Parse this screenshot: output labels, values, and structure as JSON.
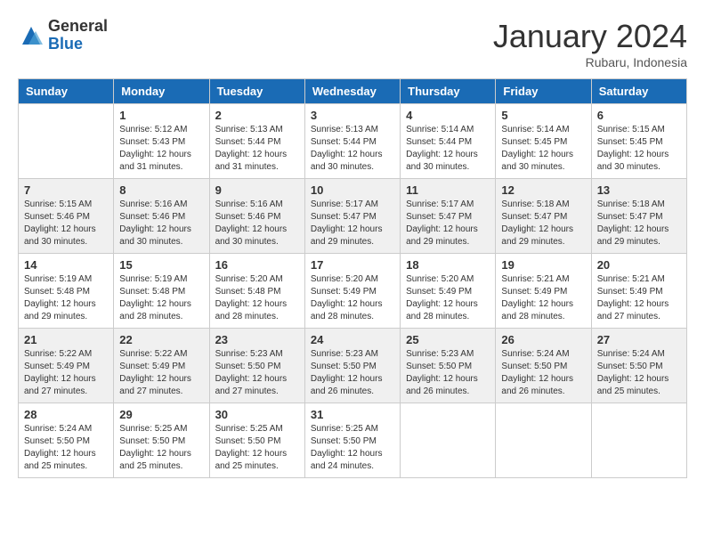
{
  "logo": {
    "general": "General",
    "blue": "Blue"
  },
  "title": "January 2024",
  "location": "Rubaru, Indonesia",
  "days_header": [
    "Sunday",
    "Monday",
    "Tuesday",
    "Wednesday",
    "Thursday",
    "Friday",
    "Saturday"
  ],
  "weeks": [
    [
      {
        "day": "",
        "sunrise": "",
        "sunset": "",
        "daylight": ""
      },
      {
        "day": "1",
        "sunrise": "Sunrise: 5:12 AM",
        "sunset": "Sunset: 5:43 PM",
        "daylight": "Daylight: 12 hours and 31 minutes."
      },
      {
        "day": "2",
        "sunrise": "Sunrise: 5:13 AM",
        "sunset": "Sunset: 5:44 PM",
        "daylight": "Daylight: 12 hours and 31 minutes."
      },
      {
        "day": "3",
        "sunrise": "Sunrise: 5:13 AM",
        "sunset": "Sunset: 5:44 PM",
        "daylight": "Daylight: 12 hours and 30 minutes."
      },
      {
        "day": "4",
        "sunrise": "Sunrise: 5:14 AM",
        "sunset": "Sunset: 5:44 PM",
        "daylight": "Daylight: 12 hours and 30 minutes."
      },
      {
        "day": "5",
        "sunrise": "Sunrise: 5:14 AM",
        "sunset": "Sunset: 5:45 PM",
        "daylight": "Daylight: 12 hours and 30 minutes."
      },
      {
        "day": "6",
        "sunrise": "Sunrise: 5:15 AM",
        "sunset": "Sunset: 5:45 PM",
        "daylight": "Daylight: 12 hours and 30 minutes."
      }
    ],
    [
      {
        "day": "7",
        "sunrise": "Sunrise: 5:15 AM",
        "sunset": "Sunset: 5:46 PM",
        "daylight": "Daylight: 12 hours and 30 minutes."
      },
      {
        "day": "8",
        "sunrise": "Sunrise: 5:16 AM",
        "sunset": "Sunset: 5:46 PM",
        "daylight": "Daylight: 12 hours and 30 minutes."
      },
      {
        "day": "9",
        "sunrise": "Sunrise: 5:16 AM",
        "sunset": "Sunset: 5:46 PM",
        "daylight": "Daylight: 12 hours and 30 minutes."
      },
      {
        "day": "10",
        "sunrise": "Sunrise: 5:17 AM",
        "sunset": "Sunset: 5:47 PM",
        "daylight": "Daylight: 12 hours and 29 minutes."
      },
      {
        "day": "11",
        "sunrise": "Sunrise: 5:17 AM",
        "sunset": "Sunset: 5:47 PM",
        "daylight": "Daylight: 12 hours and 29 minutes."
      },
      {
        "day": "12",
        "sunrise": "Sunrise: 5:18 AM",
        "sunset": "Sunset: 5:47 PM",
        "daylight": "Daylight: 12 hours and 29 minutes."
      },
      {
        "day": "13",
        "sunrise": "Sunrise: 5:18 AM",
        "sunset": "Sunset: 5:47 PM",
        "daylight": "Daylight: 12 hours and 29 minutes."
      }
    ],
    [
      {
        "day": "14",
        "sunrise": "Sunrise: 5:19 AM",
        "sunset": "Sunset: 5:48 PM",
        "daylight": "Daylight: 12 hours and 29 minutes."
      },
      {
        "day": "15",
        "sunrise": "Sunrise: 5:19 AM",
        "sunset": "Sunset: 5:48 PM",
        "daylight": "Daylight: 12 hours and 28 minutes."
      },
      {
        "day": "16",
        "sunrise": "Sunrise: 5:20 AM",
        "sunset": "Sunset: 5:48 PM",
        "daylight": "Daylight: 12 hours and 28 minutes."
      },
      {
        "day": "17",
        "sunrise": "Sunrise: 5:20 AM",
        "sunset": "Sunset: 5:49 PM",
        "daylight": "Daylight: 12 hours and 28 minutes."
      },
      {
        "day": "18",
        "sunrise": "Sunrise: 5:20 AM",
        "sunset": "Sunset: 5:49 PM",
        "daylight": "Daylight: 12 hours and 28 minutes."
      },
      {
        "day": "19",
        "sunrise": "Sunrise: 5:21 AM",
        "sunset": "Sunset: 5:49 PM",
        "daylight": "Daylight: 12 hours and 28 minutes."
      },
      {
        "day": "20",
        "sunrise": "Sunrise: 5:21 AM",
        "sunset": "Sunset: 5:49 PM",
        "daylight": "Daylight: 12 hours and 27 minutes."
      }
    ],
    [
      {
        "day": "21",
        "sunrise": "Sunrise: 5:22 AM",
        "sunset": "Sunset: 5:49 PM",
        "daylight": "Daylight: 12 hours and 27 minutes."
      },
      {
        "day": "22",
        "sunrise": "Sunrise: 5:22 AM",
        "sunset": "Sunset: 5:49 PM",
        "daylight": "Daylight: 12 hours and 27 minutes."
      },
      {
        "day": "23",
        "sunrise": "Sunrise: 5:23 AM",
        "sunset": "Sunset: 5:50 PM",
        "daylight": "Daylight: 12 hours and 27 minutes."
      },
      {
        "day": "24",
        "sunrise": "Sunrise: 5:23 AM",
        "sunset": "Sunset: 5:50 PM",
        "daylight": "Daylight: 12 hours and 26 minutes."
      },
      {
        "day": "25",
        "sunrise": "Sunrise: 5:23 AM",
        "sunset": "Sunset: 5:50 PM",
        "daylight": "Daylight: 12 hours and 26 minutes."
      },
      {
        "day": "26",
        "sunrise": "Sunrise: 5:24 AM",
        "sunset": "Sunset: 5:50 PM",
        "daylight": "Daylight: 12 hours and 26 minutes."
      },
      {
        "day": "27",
        "sunrise": "Sunrise: 5:24 AM",
        "sunset": "Sunset: 5:50 PM",
        "daylight": "Daylight: 12 hours and 25 minutes."
      }
    ],
    [
      {
        "day": "28",
        "sunrise": "Sunrise: 5:24 AM",
        "sunset": "Sunset: 5:50 PM",
        "daylight": "Daylight: 12 hours and 25 minutes."
      },
      {
        "day": "29",
        "sunrise": "Sunrise: 5:25 AM",
        "sunset": "Sunset: 5:50 PM",
        "daylight": "Daylight: 12 hours and 25 minutes."
      },
      {
        "day": "30",
        "sunrise": "Sunrise: 5:25 AM",
        "sunset": "Sunset: 5:50 PM",
        "daylight": "Daylight: 12 hours and 25 minutes."
      },
      {
        "day": "31",
        "sunrise": "Sunrise: 5:25 AM",
        "sunset": "Sunset: 5:50 PM",
        "daylight": "Daylight: 12 hours and 24 minutes."
      },
      {
        "day": "",
        "sunrise": "",
        "sunset": "",
        "daylight": ""
      },
      {
        "day": "",
        "sunrise": "",
        "sunset": "",
        "daylight": ""
      },
      {
        "day": "",
        "sunrise": "",
        "sunset": "",
        "daylight": ""
      }
    ]
  ]
}
